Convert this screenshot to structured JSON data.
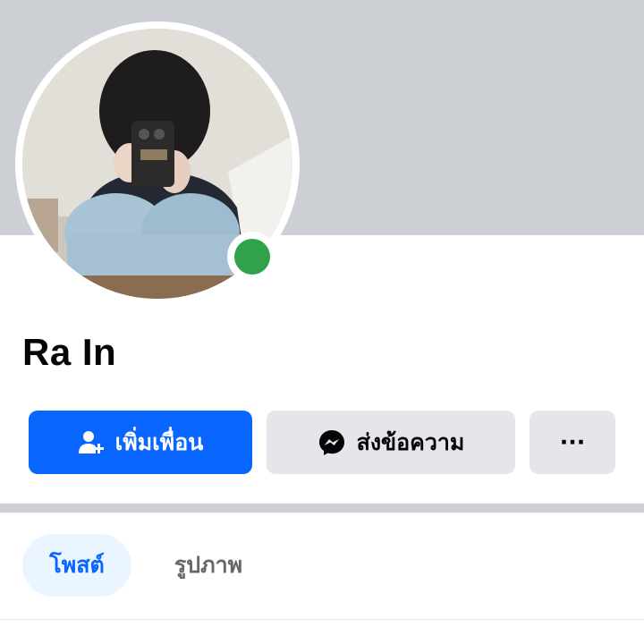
{
  "profile": {
    "name": "Ra In",
    "online": true,
    "avatar_icon": "profile-photo"
  },
  "actions": {
    "add_friend_label": "เพิ่มเพื่อน",
    "add_friend_icon": "add-friend-icon",
    "message_label": "ส่งข้อความ",
    "message_icon": "messenger-icon",
    "more_label": "···",
    "more_icon": "more-options-icon"
  },
  "tabs": [
    {
      "label": "โพสต์",
      "active": true
    },
    {
      "label": "รูปภาพ",
      "active": false
    }
  ],
  "colors": {
    "primary": "#0866ff",
    "online": "#31a24c",
    "cover": "#ccd0d5",
    "button_secondary": "#e4e6eb",
    "tab_active_bg": "#ebf5ff"
  }
}
